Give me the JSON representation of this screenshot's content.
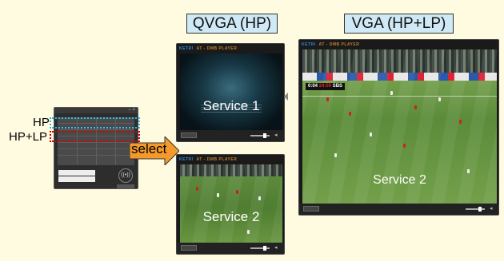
{
  "headers": {
    "qvga": "QVGA (HP)",
    "vga": "VGA (HP+LP)"
  },
  "labels": {
    "hp": "HP",
    "hplp": "HP+LP",
    "select": "select"
  },
  "panel": {
    "close_glyph": "– ×",
    "wifi_glyph": "((•))"
  },
  "players": {
    "title": "KETRI",
    "subtitle": "AT - DMB PLAYER",
    "p1_service": "Service 1",
    "p2_service": "Service 2",
    "p3_service": "Service 2",
    "score_a": "0:04",
    "score_b": "24:00",
    "score_c": "SBS"
  },
  "colors": {
    "hp_highlight": "#2dbde9",
    "hplp_highlight": "#d60000",
    "header_bg": "#cfe9f6",
    "canvas_bg": "#fffbe0",
    "arrow": "#f39a2a"
  }
}
